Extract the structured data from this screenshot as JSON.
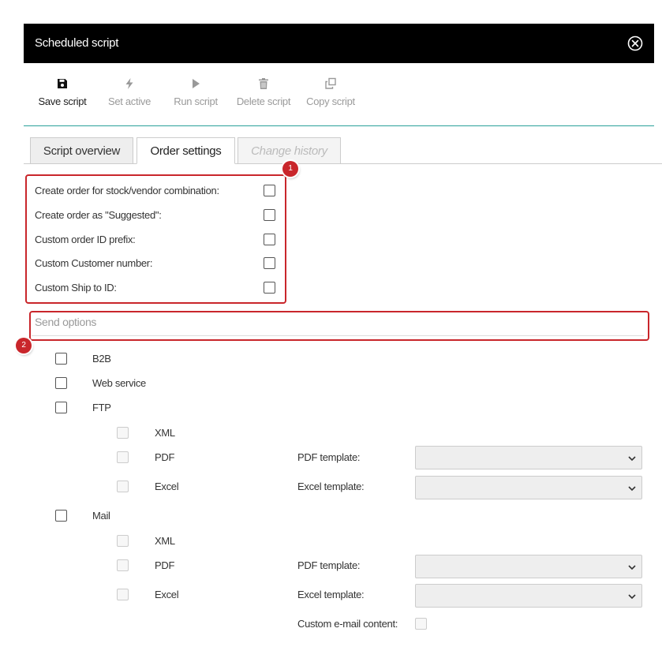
{
  "window": {
    "title": "Scheduled script"
  },
  "toolbar": {
    "save": "Save script",
    "set_active": "Set active",
    "run": "Run script",
    "delete": "Delete script",
    "copy": "Copy script"
  },
  "tabs": [
    {
      "label": "Script overview"
    },
    {
      "label": "Order settings"
    },
    {
      "label": "Change history"
    }
  ],
  "order_options": [
    {
      "label": "Create order for stock/vendor combination:"
    },
    {
      "label": "Create order as \"Suggested\":"
    },
    {
      "label": "Custom order ID prefix:"
    },
    {
      "label": "Custom Customer number:"
    },
    {
      "label": "Custom Ship to ID:"
    }
  ],
  "badges": {
    "one": "1",
    "two": "2"
  },
  "send_options": {
    "legend": "Send options",
    "b2b": "B2B",
    "web_service": "Web service",
    "ftp": "FTP",
    "ftp_xml": "XML",
    "ftp_pdf": "PDF",
    "ftp_pdf_template": "PDF template:",
    "ftp_excel": "Excel",
    "ftp_excel_template": "Excel template:",
    "mail": "Mail",
    "mail_xml": "XML",
    "mail_pdf": "PDF",
    "mail_pdf_template": "PDF template:",
    "mail_excel": "Excel",
    "mail_excel_template": "Excel template:",
    "custom_email": "Custom e-mail content:"
  },
  "colors": {
    "header_bg": "#000000",
    "accent_line": "#2aa19a",
    "highlight": "#c9262b"
  },
  "icons": [
    "close-icon",
    "save-icon",
    "lightning-icon",
    "play-icon",
    "trash-icon",
    "copy-icon",
    "chevron-down-icon"
  ]
}
